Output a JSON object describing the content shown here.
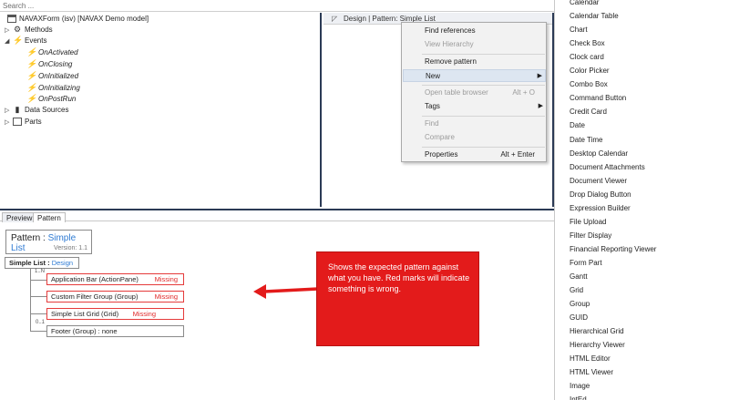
{
  "search": {
    "placeholder": "Search ..."
  },
  "tree": {
    "root": "NAVAXForm (isv) [NAVAX Demo model]",
    "methods": "Methods",
    "events": "Events",
    "event_items": [
      "OnActivated",
      "OnClosing",
      "OnInitialized",
      "OnInitializing",
      "OnPostRun"
    ],
    "data_sources": "Data Sources",
    "parts": "Parts"
  },
  "design": {
    "header": "Design | Pattern: Simple List"
  },
  "context_menu": {
    "items": [
      {
        "label": "Find references",
        "shortcut": "",
        "disabled": false
      },
      {
        "label": "View Hierarchy",
        "shortcut": "",
        "disabled": true
      },
      {
        "label": "Remove pattern",
        "shortcut": "",
        "disabled": false
      },
      {
        "label": "New",
        "shortcut": "",
        "disabled": false
      },
      {
        "label": "Open table browser",
        "shortcut": "Alt + O",
        "disabled": true
      },
      {
        "label": "Tags",
        "shortcut": "",
        "disabled": false
      },
      {
        "label": "Find",
        "shortcut": "",
        "disabled": true
      },
      {
        "label": "Compare",
        "shortcut": "",
        "disabled": true
      },
      {
        "label": "Properties",
        "shortcut": "Alt + Enter",
        "disabled": false
      }
    ]
  },
  "submenu": {
    "items": [
      "Calendar",
      "Calendar Table",
      "Chart",
      "Check Box",
      "Clock card",
      "Color Picker",
      "Combo Box",
      "Command Button",
      "Credit Card",
      "Date",
      "Date Time",
      "Desktop Calendar",
      "Document Attachments",
      "Document Viewer",
      "Drop Dialog Button",
      "Expression Builder",
      "File Upload",
      "Filter Display",
      "Financial Reporting Viewer",
      "Form Part",
      "Gantt",
      "Grid",
      "Group",
      "GUID",
      "Hierarchical Grid",
      "Hierarchy Viewer",
      "HTML Editor",
      "HTML Viewer",
      "Image",
      "IntEd"
    ]
  },
  "tabs": {
    "preview": "Preview",
    "pattern": "Pattern"
  },
  "pattern_box": {
    "prefix": "Pattern : ",
    "name": "Simple List",
    "version": "Version: 1.1"
  },
  "root_node": {
    "label": "Simple List : ",
    "value": "Design"
  },
  "children": [
    {
      "cardinality": "1..N",
      "label": "Application Bar (ActionPane)",
      "status": "Missing"
    },
    {
      "cardinality": "",
      "label": "Custom Filter Group (Group)",
      "status": "Missing"
    },
    {
      "cardinality": "",
      "label": "Simple List Grid (Grid)",
      "status": "Missing"
    },
    {
      "cardinality": "0..1",
      "label": "Footer (Group) : none",
      "status": ""
    }
  ],
  "callout": {
    "text": "Shows the expected pattern against what you have. Red marks will indicate something is wrong."
  },
  "colors": {
    "accent_blue": "#2f7bd3",
    "missing_red": "#e02a2a",
    "callout_red": "#e31b1b",
    "pane_border": "#2b3a55"
  }
}
